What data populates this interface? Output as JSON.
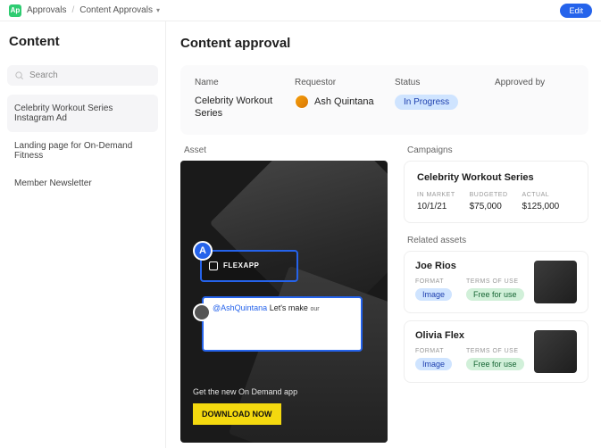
{
  "topbar": {
    "app_badge": "Ap",
    "crumb_root": "Approvals",
    "crumb_current": "Content Approvals",
    "edit_label": "Edit"
  },
  "sidebar": {
    "title": "Content",
    "search_placeholder": "Search",
    "items": [
      "Celebrity Workout Series Instagram Ad",
      "Landing page for On-Demand Fitness",
      "Member Newsletter"
    ]
  },
  "main": {
    "title": "Content approval",
    "columns": {
      "name_label": "Name",
      "requestor_label": "Requestor",
      "status_label": "Status",
      "approved_by_label": "Approved by"
    },
    "record": {
      "name": "Celebrity Workout Series",
      "requestor": "Ash Quintana",
      "status": "In Progress",
      "approved_by": ""
    }
  },
  "asset": {
    "section_label": "Asset",
    "label_app": "FLEXAPP",
    "annotation_pin": "A",
    "comment_mention": "@AshQuintana",
    "comment_body": "Let's make",
    "comment_tail": "our",
    "copy_line": "Get the new On Demand app",
    "download_label": "DOWNLOAD NOW"
  },
  "campaigns": {
    "section_label": "Campaigns",
    "card": {
      "title": "Celebrity Workout Series",
      "cols": [
        {
          "k": "In Market",
          "v": "10/1/21"
        },
        {
          "k": "Budgeted",
          "v": "$75,000"
        },
        {
          "k": "Actual",
          "v": "$125,000"
        }
      ]
    }
  },
  "related": {
    "section_label": "Related assets",
    "items": [
      {
        "name": "Joe Rios",
        "format_label": "Format",
        "format": "Image",
        "terms_label": "Terms of use",
        "terms": "Free for use"
      },
      {
        "name": "Olivia Flex",
        "format_label": "Format",
        "format": "Image",
        "terms_label": "Terms of use",
        "terms": "Free for use"
      }
    ]
  }
}
